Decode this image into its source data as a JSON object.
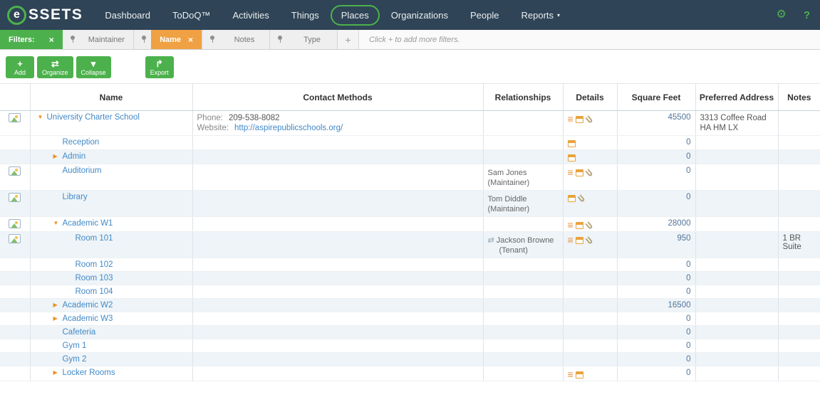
{
  "nav": {
    "brand_prefix": "e",
    "brand_rest": "SSETS",
    "items": [
      {
        "label": "Dashboard"
      },
      {
        "label": "ToDoQ™"
      },
      {
        "label": "Activities"
      },
      {
        "label": "Things"
      },
      {
        "label": "Places",
        "active": true
      },
      {
        "label": "Organizations"
      },
      {
        "label": "People"
      },
      {
        "label": "Reports",
        "caret": true
      }
    ],
    "gear_icon": "⚙",
    "help_label": "?"
  },
  "filters": {
    "label": "Filters:",
    "tabs": [
      {
        "label": "Maintainer",
        "state": "normal"
      },
      {
        "label": "Name",
        "state": "active"
      },
      {
        "label": "Notes",
        "state": "normal"
      },
      {
        "label": "Type",
        "state": "normal"
      }
    ],
    "add_label": "+",
    "hint": "Click + to add more filters."
  },
  "toolbar": {
    "buttons": [
      {
        "label": "Add",
        "icon": "plus"
      },
      {
        "label": "Organize",
        "icon": "shuffle"
      },
      {
        "label": "Collapse",
        "icon": "caret_down"
      },
      {
        "label": "Export",
        "icon": "export",
        "separate": true
      }
    ]
  },
  "icons": {
    "close": "×",
    "plus": "+",
    "shuffle": "⇄",
    "caret_down": "▾",
    "export": "↱",
    "swap": "⇄",
    "list": "≡",
    "expander_open": "▼",
    "expander_closed": "▶"
  },
  "table": {
    "headers": [
      "Name",
      "Contact Methods",
      "Relationships",
      "Details",
      "Square Feet",
      "Preferred Address",
      "Notes"
    ],
    "rows": [
      {
        "name": "University Charter School",
        "level": 0,
        "expander": "open",
        "image": true,
        "contact": {
          "phone_label": "Phone:",
          "phone": "209-538-8082",
          "website_label": "Website:",
          "website": "http://aspirepublicschools.org/"
        },
        "details": [
          "list",
          "calendar",
          "paperclip"
        ],
        "sqft": "45500",
        "address": [
          "3313 Coffee Road",
          "HA HM LX"
        ]
      },
      {
        "name": "Reception",
        "level": 1,
        "expander": "none",
        "details": [
          "calendar"
        ],
        "sqft": "0"
      },
      {
        "name": "Admin",
        "level": 1,
        "expander": "closed",
        "details": [
          "calendar"
        ],
        "sqft": "0"
      },
      {
        "name": "Auditorium",
        "level": 1,
        "expander": "none",
        "image": true,
        "relationship": {
          "name": "Sam Jones",
          "role": "(Maintainer)"
        },
        "details": [
          "list",
          "calendar",
          "paperclip"
        ],
        "sqft": "0"
      },
      {
        "name": "Library",
        "level": 1,
        "expander": "none",
        "image": true,
        "relationship": {
          "name": "Tom Diddle",
          "role": "(Maintainer)"
        },
        "details": [
          "calendar",
          "paperclip"
        ],
        "sqft": "0"
      },
      {
        "name": "Academic W1",
        "level": 1,
        "expander": "open",
        "image": true,
        "details": [
          "list",
          "calendar",
          "paperclip"
        ],
        "sqft": "28000"
      },
      {
        "name": "Room 101",
        "level": 2,
        "expander": "none",
        "image": true,
        "relationship": {
          "icon": "swap",
          "name": "Jackson Browne",
          "role": "(Tenant)"
        },
        "details": [
          "list",
          "calendar",
          "paperclip"
        ],
        "sqft": "950",
        "note": "1 BR Suite"
      },
      {
        "name": "Room 102",
        "level": 2,
        "expander": "none",
        "sqft": "0"
      },
      {
        "name": "Room 103",
        "level": 2,
        "expander": "none",
        "sqft": "0"
      },
      {
        "name": "Room 104",
        "level": 2,
        "expander": "none",
        "sqft": "0"
      },
      {
        "name": "Academic W2",
        "level": 1,
        "expander": "closed",
        "sqft": "16500"
      },
      {
        "name": "Academic W3",
        "level": 1,
        "expander": "closed",
        "sqft": "0"
      },
      {
        "name": "Cafeteria",
        "level": 1,
        "expander": "none",
        "sqft": "0"
      },
      {
        "name": "Gym 1",
        "level": 1,
        "expander": "none",
        "sqft": "0"
      },
      {
        "name": "Gym 2",
        "level": 1,
        "expander": "none",
        "sqft": "0"
      },
      {
        "name": "Locker Rooms",
        "level": 1,
        "expander": "closed",
        "details": [
          "list",
          "calendar"
        ],
        "sqft": "0"
      }
    ]
  },
  "colors": {
    "accent_green": "#4cb14c",
    "accent_orange": "#efa143",
    "arrow_orange": "#ee8f22",
    "link_blue": "#4289c7",
    "nav_bg": "#2f4456",
    "row_alt": "#eef4f8"
  }
}
